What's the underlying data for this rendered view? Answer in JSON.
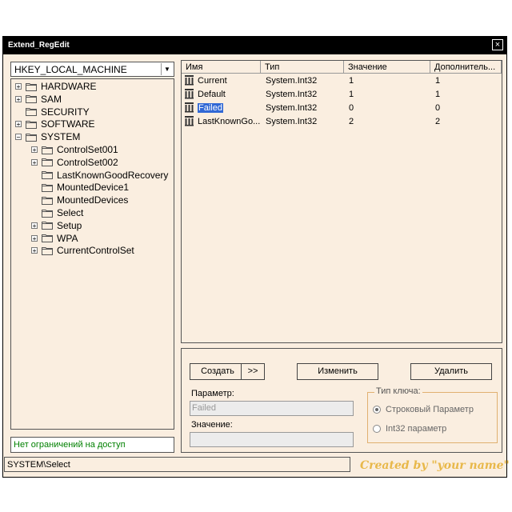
{
  "window": {
    "title": "Extend_RegEdit",
    "close_label": "×"
  },
  "hive_combo": {
    "value": "HKEY_LOCAL_MACHINE"
  },
  "tree": [
    {
      "label": "HARDWARE",
      "expander": "+",
      "level": 0
    },
    {
      "label": "SAM",
      "expander": "+",
      "level": 0
    },
    {
      "label": "SECURITY",
      "expander": "",
      "level": 0
    },
    {
      "label": "SOFTWARE",
      "expander": "+",
      "level": 0
    },
    {
      "label": "SYSTEM",
      "expander": "−",
      "level": 0
    },
    {
      "label": "ControlSet001",
      "expander": "+",
      "level": 1
    },
    {
      "label": "ControlSet002",
      "expander": "+",
      "level": 1
    },
    {
      "label": "LastKnownGoodRecovery",
      "expander": "",
      "level": 1
    },
    {
      "label": "MountedDevice1",
      "expander": "",
      "level": 1
    },
    {
      "label": "MountedDevices",
      "expander": "",
      "level": 1
    },
    {
      "label": "Select",
      "expander": "",
      "level": 1
    },
    {
      "label": "Setup",
      "expander": "+",
      "level": 1
    },
    {
      "label": "WPA",
      "expander": "+",
      "level": 1
    },
    {
      "label": "CurrentControlSet",
      "expander": "+",
      "level": 1
    }
  ],
  "access_status": "Нет ограничений на доступ",
  "current_path": "SYSTEM\\Select",
  "credit": "Created by \"your name\"",
  "list": {
    "columns": [
      "Имя",
      "Тип",
      "Значение",
      "Дополнитель..."
    ],
    "rows": [
      {
        "name": "Current",
        "type": "System.Int32",
        "value": "1",
        "extra": "1"
      },
      {
        "name": "Default",
        "type": "System.Int32",
        "value": "1",
        "extra": "1"
      },
      {
        "name": "Failed",
        "type": "System.Int32",
        "value": "0",
        "extra": "0"
      },
      {
        "name": "LastKnownGo...",
        "type": "System.Int32",
        "value": "2",
        "extra": "2"
      }
    ]
  },
  "editor": {
    "create_label": "Создать",
    "more_label": ">>",
    "modify_label": "Изменить",
    "delete_label": "Удалить",
    "param_label": "Параметр:",
    "param_value": "Failed",
    "value_label": "Значение:",
    "value_value": "",
    "key_type_title": "Тип ключа:",
    "string_option": "Строковый Параметр",
    "int_option": "Int32 параметр"
  }
}
